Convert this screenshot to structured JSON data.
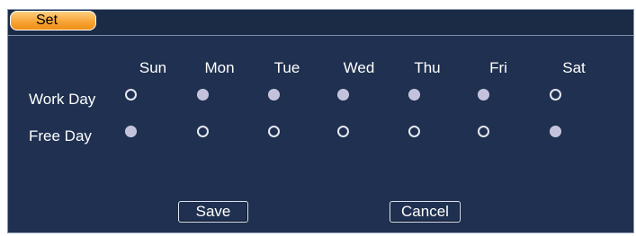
{
  "tab": {
    "label": "Set"
  },
  "days": [
    "Sun",
    "Mon",
    "Tue",
    "Wed",
    "Thu",
    "Fri",
    "Sat"
  ],
  "rows": [
    {
      "label": "Work Day",
      "selected": [
        false,
        true,
        true,
        true,
        true,
        true,
        false
      ]
    },
    {
      "label": "Free Day",
      "selected": [
        true,
        false,
        false,
        false,
        false,
        false,
        true
      ]
    }
  ],
  "buttons": {
    "save": "Save",
    "cancel": "Cancel"
  },
  "colors": {
    "panel_bg": "#1f3050",
    "tab_accent": "#f7a437",
    "radio_selected": "#c3c1dc",
    "text": "#ffffff"
  }
}
